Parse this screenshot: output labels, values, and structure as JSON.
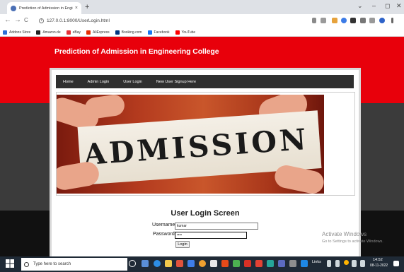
{
  "browser": {
    "tab_title": "Prediction of Admission in Engin",
    "tab_close": "×",
    "new_tab": "+",
    "window_controls": {
      "chevron": "⌄",
      "minimize": "–",
      "maximize": "◻",
      "close": "✕"
    },
    "url": "127.0.0.1:8000/UserLogin.html",
    "nav": {
      "back": "←",
      "forward": "→",
      "reload": "C"
    },
    "bookmarks": [
      {
        "label": "Addons Store",
        "color": "#2b6fd6"
      },
      {
        "label": "Amazon.de",
        "color": "#222222"
      },
      {
        "label": "eBay",
        "color": "#e53238"
      },
      {
        "label": "AliExpress",
        "color": "#e62e04"
      },
      {
        "label": "Booking.com",
        "color": "#003580"
      },
      {
        "label": "Facebook",
        "color": "#1877f2"
      },
      {
        "label": "YouTube",
        "color": "#ff0000"
      }
    ]
  },
  "site": {
    "title": "Prediction of Admission in Engineering College",
    "nav": [
      "Home",
      "Admin Login",
      "User Login",
      "New User Signup Here"
    ],
    "banner_text": "ADMISSION"
  },
  "login": {
    "title": "User Login Screen",
    "username_label": "Username",
    "username_value": "kumar",
    "password_label": "Password",
    "password_value": "••••",
    "button": "Login"
  },
  "watermark": {
    "line1": "Activate Windows",
    "line2": "Go to Settings to activate Windows."
  },
  "taskbar": {
    "search_placeholder": "Type here to search",
    "links": "Links",
    "time": "14:52",
    "date": "08-11-2022"
  },
  "colors": {
    "header_red": "#e8000b",
    "nav_dark": "#2f2f2f",
    "band_dark": "#3b3b3b"
  }
}
